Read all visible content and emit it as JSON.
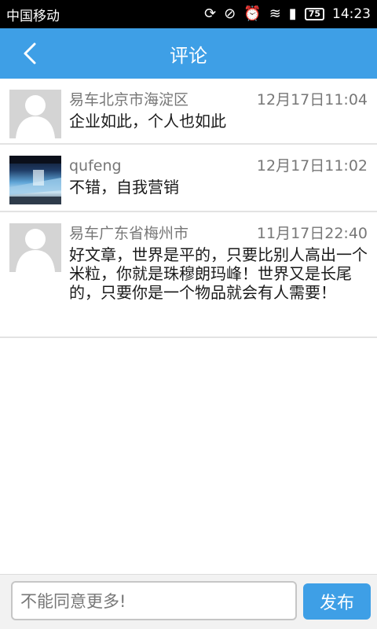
{
  "status_bar": {
    "carrier": "中国移动",
    "battery": "75",
    "time": "14:23",
    "icons": [
      "sync-icon",
      "no-vibrate-icon",
      "alarm-icon",
      "wifi-icon",
      "signal-icon",
      "battery-icon"
    ]
  },
  "header": {
    "title": "评论",
    "back_icon": "chevron-left-icon"
  },
  "comments": [
    {
      "author": "易车北京市海淀区",
      "time": "12月17日11:04",
      "text": "企业如此，个人也如此",
      "avatar": "default-person"
    },
    {
      "author": "qufeng",
      "time": "12月17日11:02",
      "text": "不错，自我营销",
      "avatar": "photo"
    },
    {
      "author": "易车广东省梅州市",
      "time": "11月17日22:40",
      "text": "好文章，世界是平的，只要比别人高出一个米粒，你就是珠穆朗玛峰！世界又是长尾的，只要你是一个物品就会有人需要！",
      "avatar": "default-person"
    }
  ],
  "composer": {
    "value": "不能同意更多!",
    "send_label": "发布"
  },
  "colors": {
    "accent": "#3e9fe6",
    "meta_text": "#777777",
    "body_text": "#1a1a1a",
    "divider": "#e3e3e3"
  }
}
